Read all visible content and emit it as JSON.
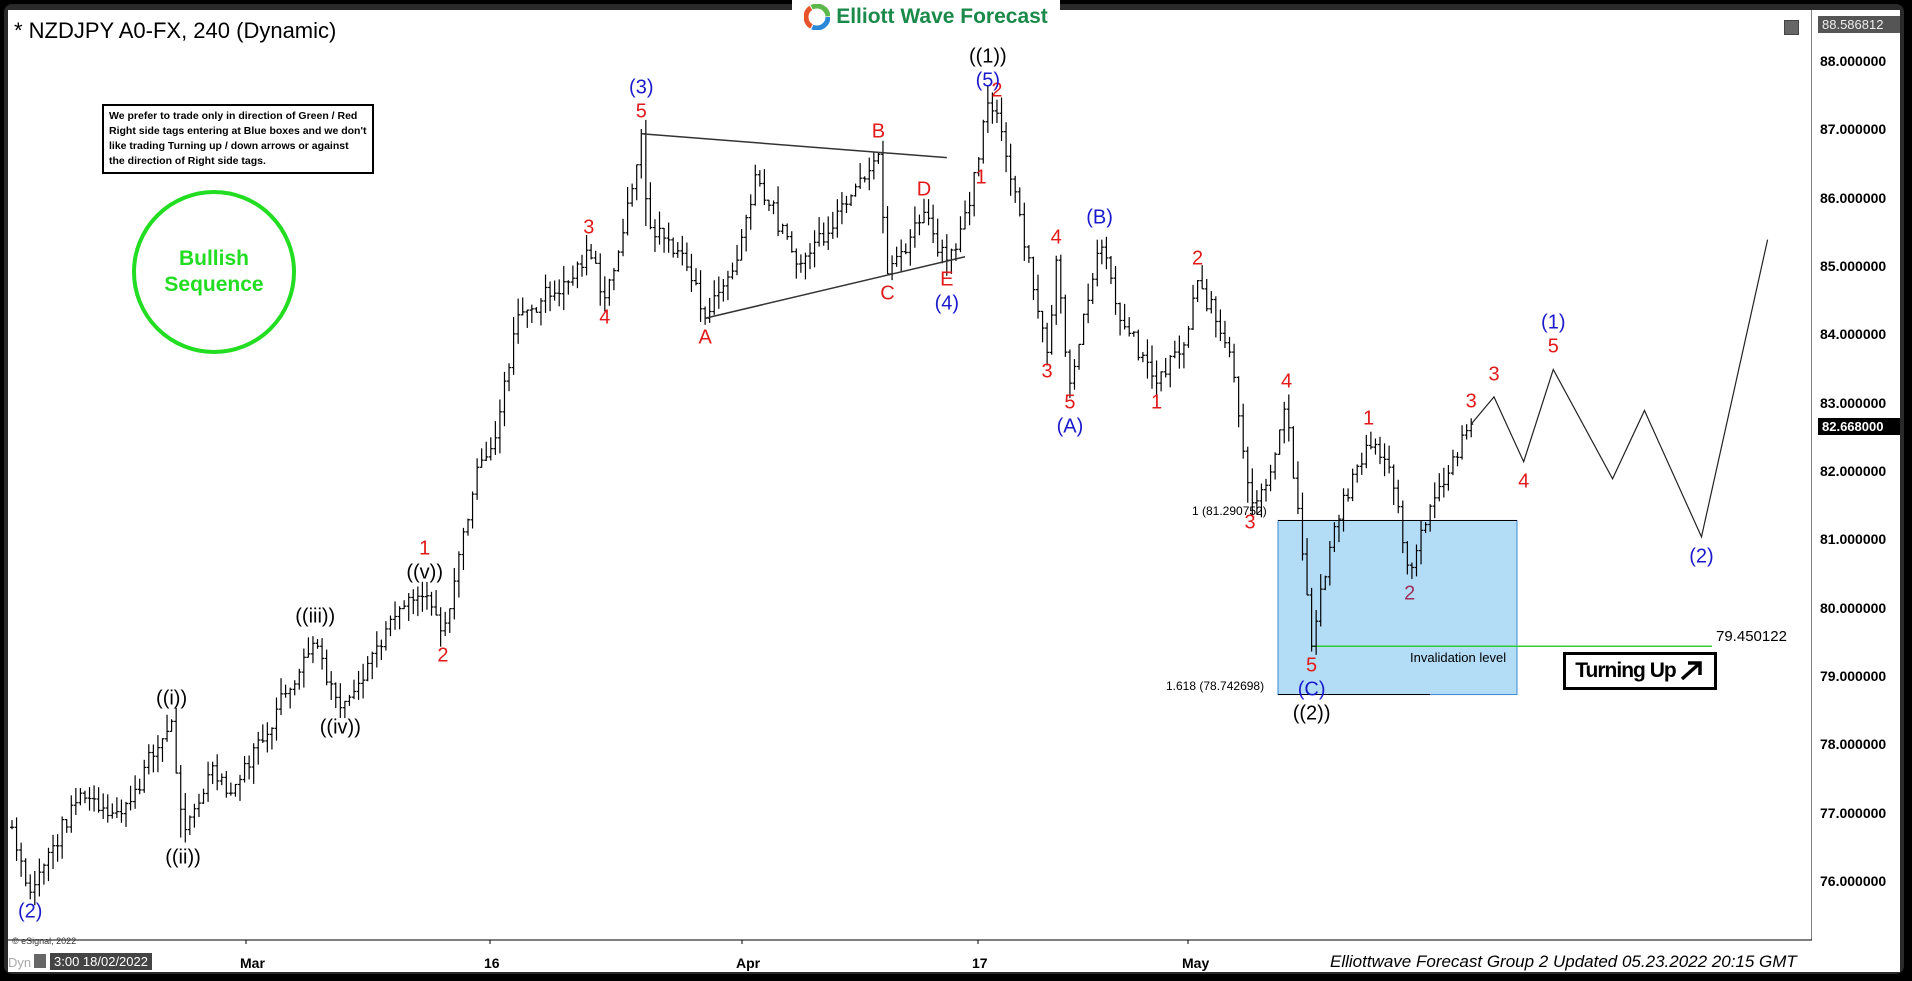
{
  "header": {
    "title": "* NZDJPY A0-FX, 240 (Dynamic)",
    "brand": "Elliott Wave Forecast"
  },
  "note_box": "We prefer to trade only in direction of Green / Red Right side tags entering at Blue boxes and we don't like trading Turning up / down arrows or against the direction of Right side tags.",
  "sequence_badge": {
    "line1": "Bullish",
    "line2": "Sequence",
    "color": "#22dd22"
  },
  "price_axis": {
    "top_flag": "88.586812",
    "current_price": "82.668000",
    "ticks": [
      "88.000000",
      "87.000000",
      "86.000000",
      "85.000000",
      "84.000000",
      "83.000000",
      "82.000000",
      "81.000000",
      "80.000000",
      "79.000000",
      "78.000000",
      "77.000000",
      "76.000000"
    ]
  },
  "time_axis": {
    "cursor_date": "3:00 18/02/2022",
    "dyn_label": "Dyn",
    "labels": [
      "Mar",
      "16",
      "Apr",
      "17",
      "May"
    ]
  },
  "footer": "Elliottwave Forecast Group 2 Updated 05.23.2022 20:15 GMT",
  "copyright": "© eSignal, 2022",
  "blue_box": {
    "upper_label": "1 (81.290752)",
    "lower_label": "1.618 (78.742698)",
    "upper": 81.290752,
    "lower": 78.742698,
    "color": "#b3dcf7"
  },
  "invalidation": {
    "label": "Invalidation level",
    "value": "79.450122",
    "price": 79.450122,
    "color": "#33cc33"
  },
  "turning_up": {
    "label": "Turning Up",
    "icon": "arrow-up-right-icon"
  },
  "chart_data": {
    "type": "ohlc",
    "symbol": "NZDJPY",
    "timeframe": "240",
    "ylim": [
      75.3,
      88.6
    ],
    "x_tick_labels": [
      "Mar",
      "16",
      "Apr",
      "17",
      "May"
    ],
    "pivots": [
      {
        "label": "(2)",
        "color": "blue",
        "bar": 8,
        "price": 75.85,
        "pos": "below"
      },
      {
        "label": "((i))",
        "color": "black",
        "bar": 70,
        "price": 78.35,
        "pos": "above"
      },
      {
        "label": "((ii))",
        "color": "black",
        "bar": 75,
        "price": 76.65,
        "pos": "below"
      },
      {
        "label": "((iii))",
        "color": "black",
        "bar": 133,
        "price": 79.55,
        "pos": "above"
      },
      {
        "label": "((iv))",
        "color": "black",
        "bar": 144,
        "price": 78.55,
        "pos": "below"
      },
      {
        "label": "((v))",
        "color": "black",
        "bar": 181,
        "price": 80.2,
        "pos": "above"
      },
      {
        "label": "1",
        "color": "red",
        "bar": 181,
        "price": 80.2,
        "pos": "above2"
      },
      {
        "label": "2",
        "color": "red",
        "bar": 189,
        "price": 79.6,
        "pos": "below"
      },
      {
        "label": "3",
        "color": "red",
        "bar": 253,
        "price": 85.25,
        "pos": "above"
      },
      {
        "label": "4",
        "color": "red",
        "bar": 260,
        "price": 84.55,
        "pos": "below"
      },
      {
        "label": "5",
        "color": "red",
        "bar": 276,
        "price": 86.95,
        "pos": "above"
      },
      {
        "label": "(3)",
        "color": "blue",
        "bar": 276,
        "price": 86.95,
        "pos": "above2"
      },
      {
        "label": "A",
        "color": "red",
        "bar": 304,
        "price": 84.25,
        "pos": "below"
      },
      {
        "label": "B",
        "color": "red",
        "bar": 380,
        "price": 86.65,
        "pos": "above"
      },
      {
        "label": "C",
        "color": "red",
        "bar": 384,
        "price": 84.9,
        "pos": "below"
      },
      {
        "label": "D",
        "color": "red",
        "bar": 400,
        "price": 85.8,
        "pos": "above"
      },
      {
        "label": "E",
        "color": "red",
        "bar": 410,
        "price": 85.1,
        "pos": "below"
      },
      {
        "label": "(4)",
        "color": "blue",
        "bar": 410,
        "price": 85.1,
        "pos": "below2"
      },
      {
        "label": "1",
        "color": "red",
        "bar": 425,
        "price": 86.6,
        "pos": "below"
      },
      {
        "label": "2",
        "color": "red",
        "bar": 432,
        "price": 87.25,
        "pos": "above"
      },
      {
        "label": "(5)",
        "color": "blue",
        "bar": 428,
        "price": 87.4,
        "pos": "above"
      },
      {
        "label": "((1))",
        "color": "black",
        "bar": 428,
        "price": 87.4,
        "pos": "above2"
      },
      {
        "label": "3",
        "color": "red",
        "bar": 454,
        "price": 83.75,
        "pos": "below"
      },
      {
        "label": "4",
        "color": "red",
        "bar": 458,
        "price": 85.1,
        "pos": "above"
      },
      {
        "label": "5",
        "color": "red",
        "bar": 464,
        "price": 83.3,
        "pos": "below"
      },
      {
        "label": "(A)",
        "color": "blue",
        "bar": 464,
        "price": 83.3,
        "pos": "below2"
      },
      {
        "label": "(B)",
        "color": "blue",
        "bar": 477,
        "price": 85.4,
        "pos": "above"
      },
      {
        "label": "1",
        "color": "red",
        "bar": 502,
        "price": 83.3,
        "pos": "below"
      },
      {
        "label": "2",
        "color": "red",
        "bar": 520,
        "price": 84.8,
        "pos": "above"
      },
      {
        "label": "3",
        "color": "red",
        "bar": 543,
        "price": 81.55,
        "pos": "below"
      },
      {
        "label": "4",
        "color": "red",
        "bar": 559,
        "price": 83.0,
        "pos": "above"
      },
      {
        "label": "5",
        "color": "red",
        "bar": 570,
        "price": 79.45,
        "pos": "below"
      },
      {
        "label": "(C)",
        "color": "blue",
        "bar": 570,
        "price": 79.45,
        "pos": "below2"
      },
      {
        "label": "((2))",
        "color": "black",
        "bar": 570,
        "price": 79.45,
        "pos": "below3"
      },
      {
        "label": "1",
        "color": "red",
        "bar": 595,
        "price": 82.45,
        "pos": "above"
      },
      {
        "label": "2",
        "color": "plum",
        "bar": 613,
        "price": 80.5,
        "pos": "below"
      },
      {
        "label": "3",
        "color": "red",
        "bar": 640,
        "price": 82.7,
        "pos": "above"
      }
    ],
    "triangle": {
      "upper": [
        [
          276,
          86.95
        ],
        [
          410,
          86.6
        ]
      ],
      "lower": [
        [
          304,
          84.25
        ],
        [
          418,
          85.15
        ]
      ]
    },
    "projection": {
      "points": [
        [
          640,
          82.7
        ],
        [
          650,
          83.1
        ],
        [
          663,
          82.15
        ],
        [
          676,
          83.5
        ],
        [
          702,
          81.9
        ],
        [
          716,
          82.9
        ],
        [
          741,
          81.05
        ],
        [
          770,
          85.4
        ]
      ],
      "labels": [
        {
          "label": "3",
          "color": "red",
          "i": 1,
          "pos": "above"
        },
        {
          "label": "4",
          "color": "red",
          "i": 2,
          "pos": "below"
        },
        {
          "label": "5",
          "color": "red",
          "i": 3,
          "pos": "above"
        },
        {
          "label": "(1)",
          "color": "blue",
          "i": 3,
          "pos": "above2"
        },
        {
          "label": "(2)",
          "color": "blue",
          "i": 6,
          "pos": "below"
        }
      ]
    },
    "last_bar": 640,
    "title": "NZDJPY A0-FX, 240 (Dynamic)"
  }
}
